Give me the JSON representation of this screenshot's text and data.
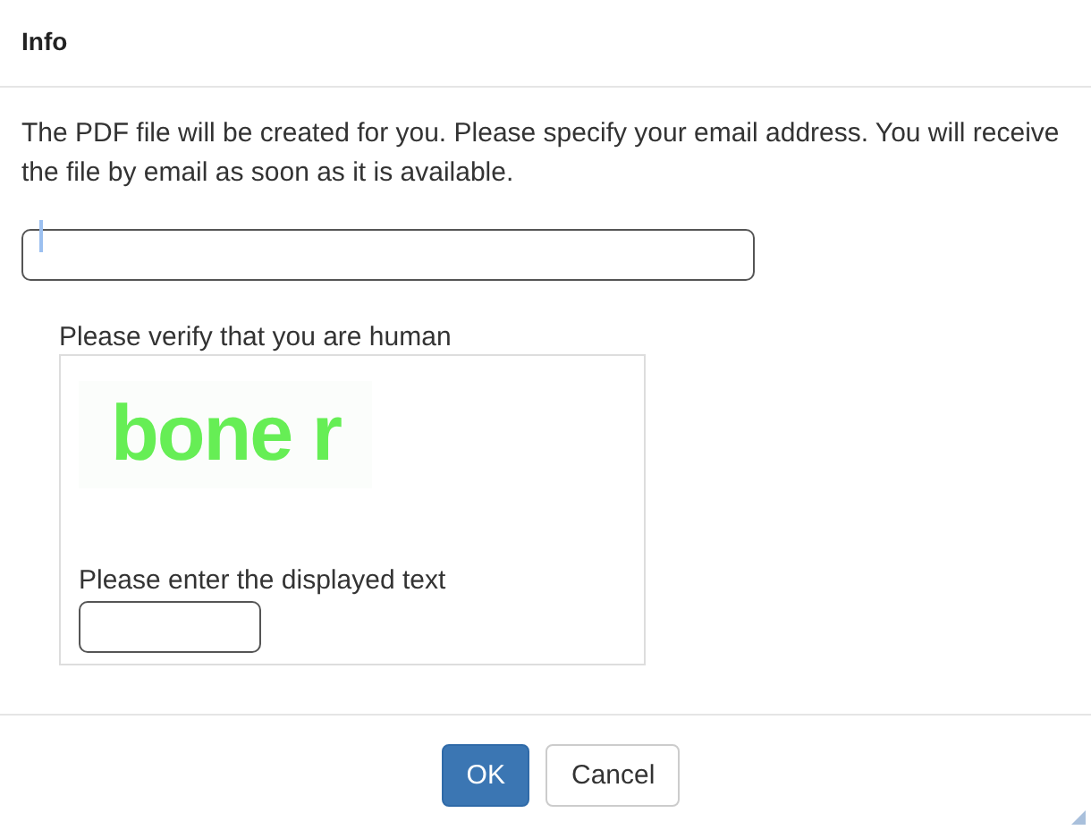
{
  "dialog": {
    "title": "Info"
  },
  "message": "The PDF file will be created for you. Please specify your email address. You will receive the file by email as soon as it is available.",
  "email_field": {
    "focused": true
  },
  "captcha": {
    "label": "Please verify that you are human",
    "image_text": "bone r",
    "prompt": "Please enter the displayed text"
  },
  "buttons": [
    {
      "label": "OK",
      "kind": "primary"
    },
    {
      "label": "Cancel",
      "kind": "default"
    }
  ]
}
